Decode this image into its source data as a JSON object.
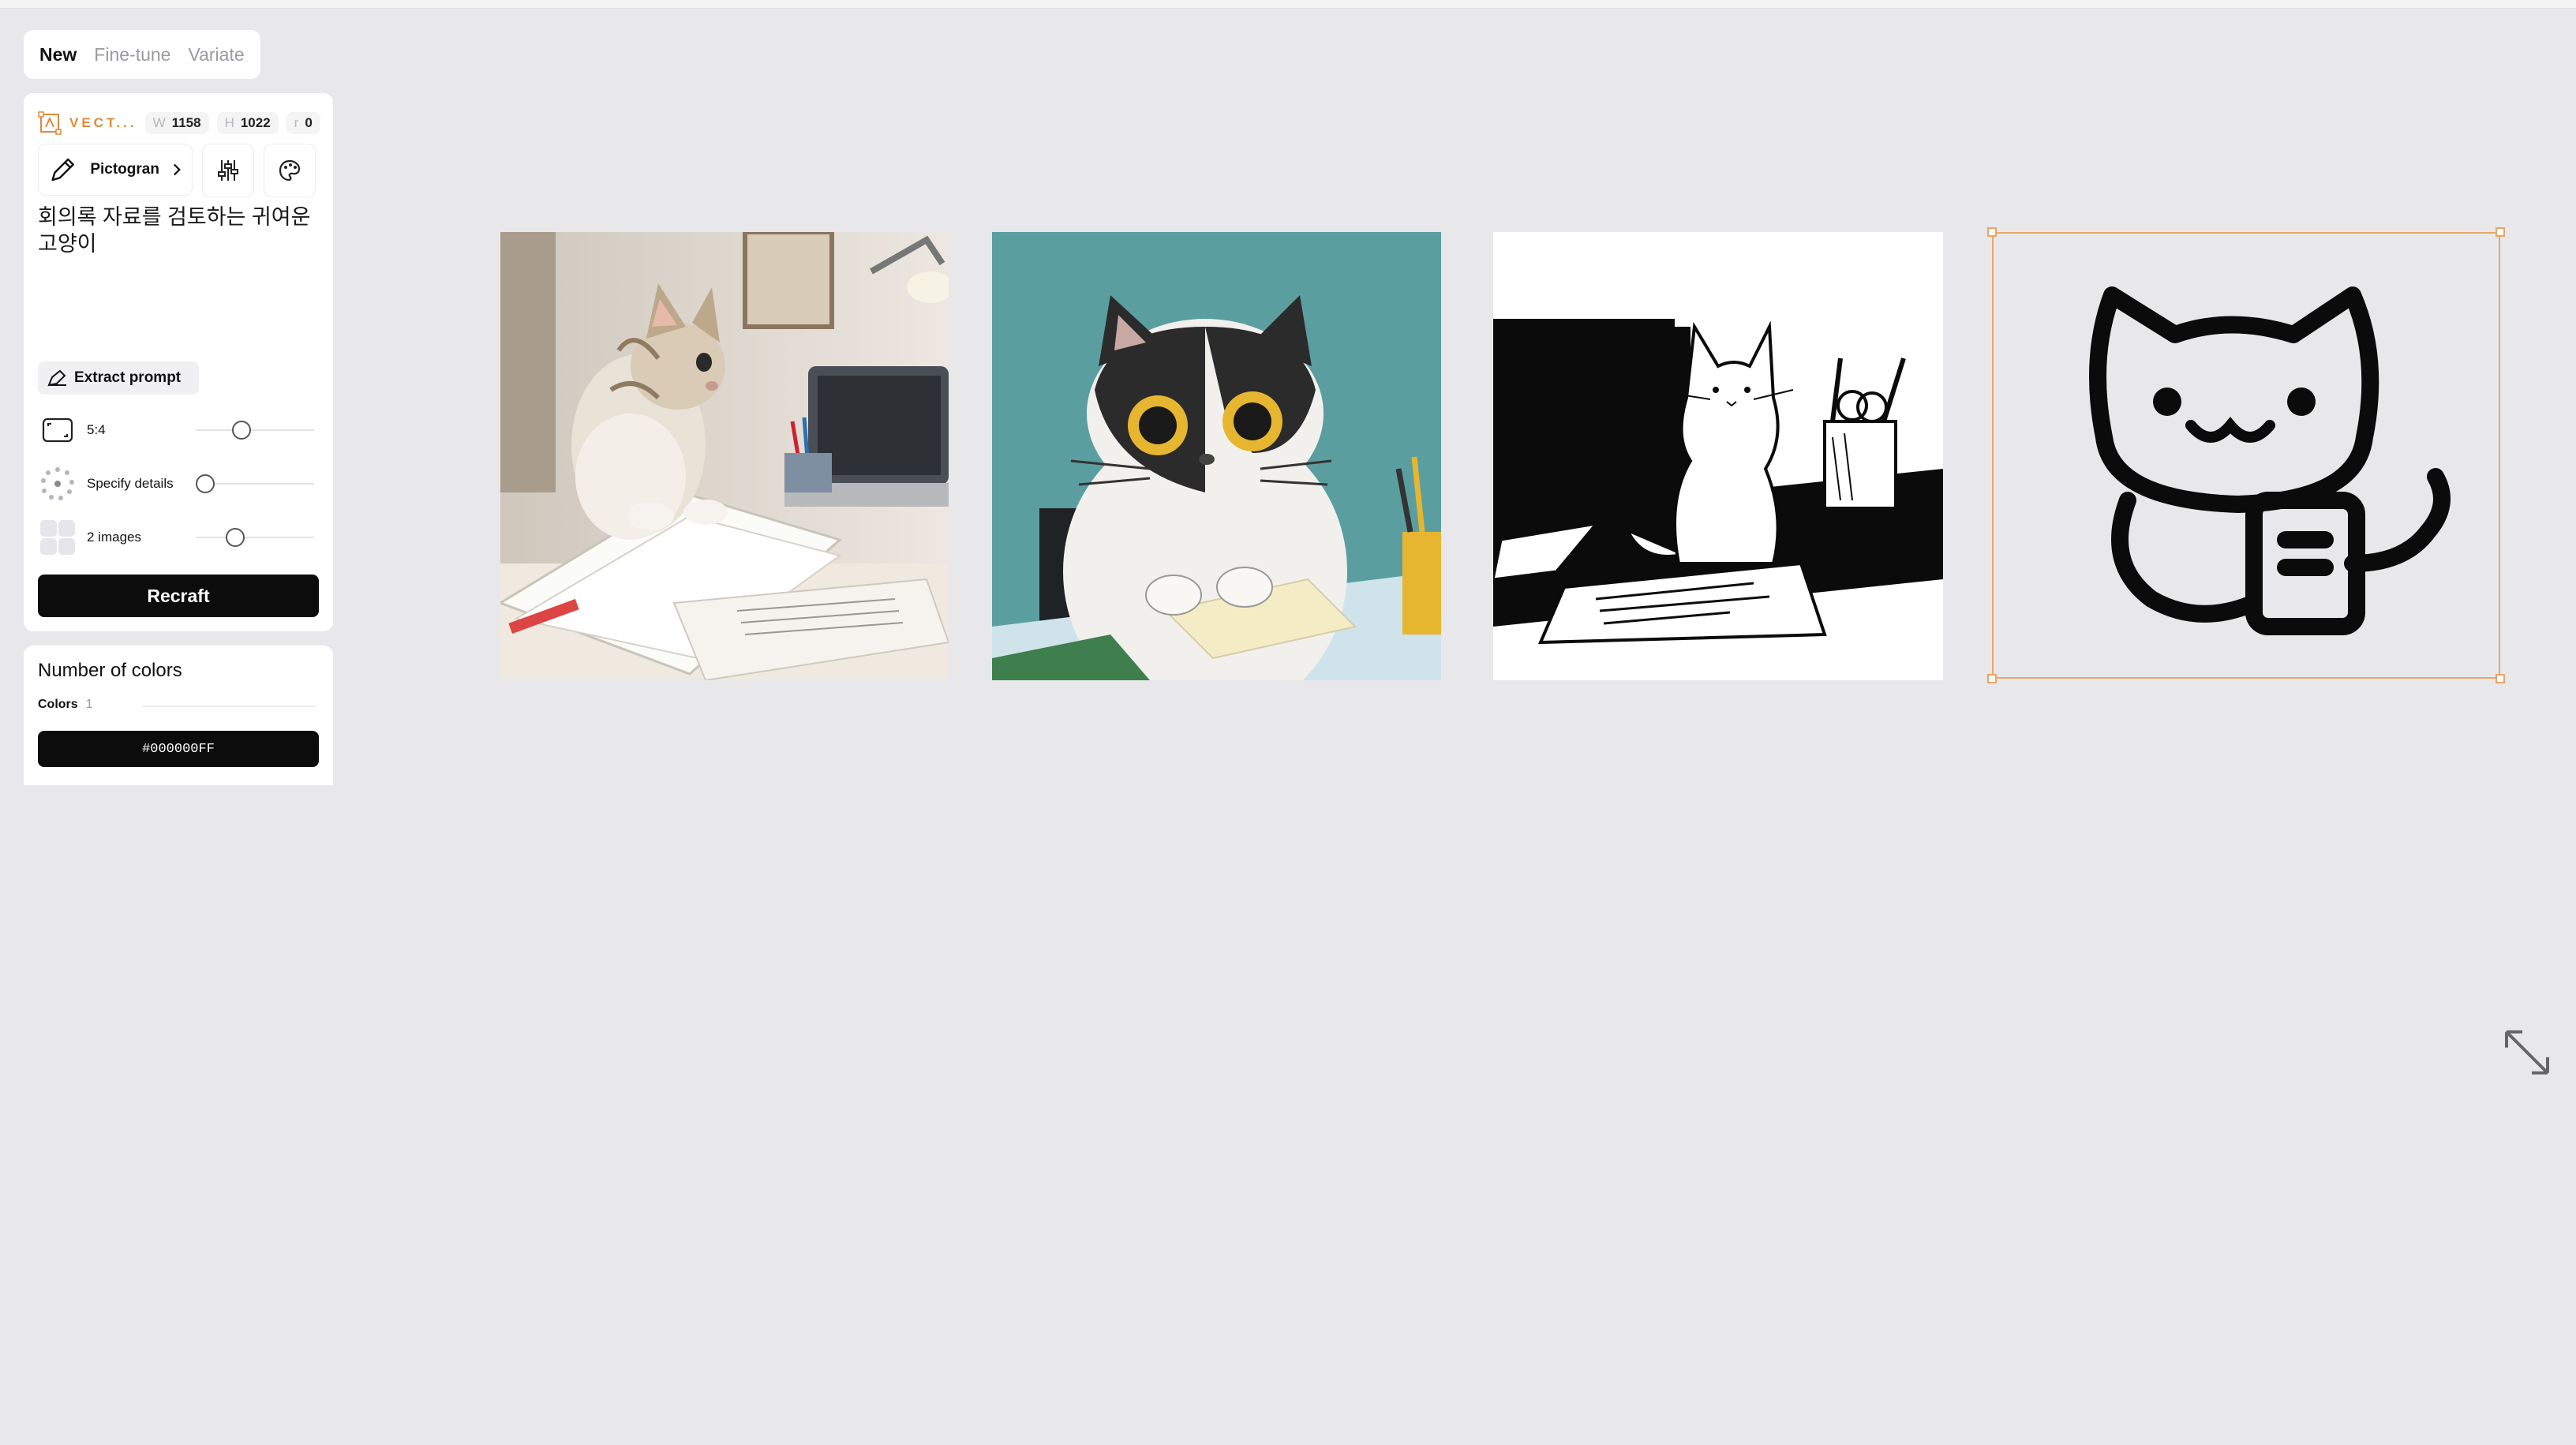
{
  "tabs": [
    {
      "label": "New",
      "active": true
    },
    {
      "label": "Fine-tune",
      "active": false
    },
    {
      "label": "Variate",
      "active": false
    }
  ],
  "panel": {
    "type_label": "VECT...",
    "width_key": "W",
    "width_value": "1158",
    "height_key": "H",
    "height_value": "1022",
    "rotate_key": "r",
    "rotate_value": "0",
    "style_name": "Pictogran",
    "prompt_text": "회의록 자료를 검토하는 귀여운 고양이",
    "extract_label": "Extract prompt",
    "aspect_label": "5:4",
    "details_label": "Specify details",
    "images_label": "2 images",
    "recraft_label": "Recraft"
  },
  "colors_panel": {
    "title": "Number of colors",
    "colors_key": "Colors",
    "colors_value": "1",
    "hex_value": "#000000FF"
  },
  "accent_color": "#e8a66c",
  "gallery": [
    {
      "name": "photo-kitten-on-documents"
    },
    {
      "name": "illustration-cat-at-desk"
    },
    {
      "name": "lineart-cat-on-desk"
    },
    {
      "name": "pictogram-cat-with-document",
      "selected": true
    }
  ]
}
